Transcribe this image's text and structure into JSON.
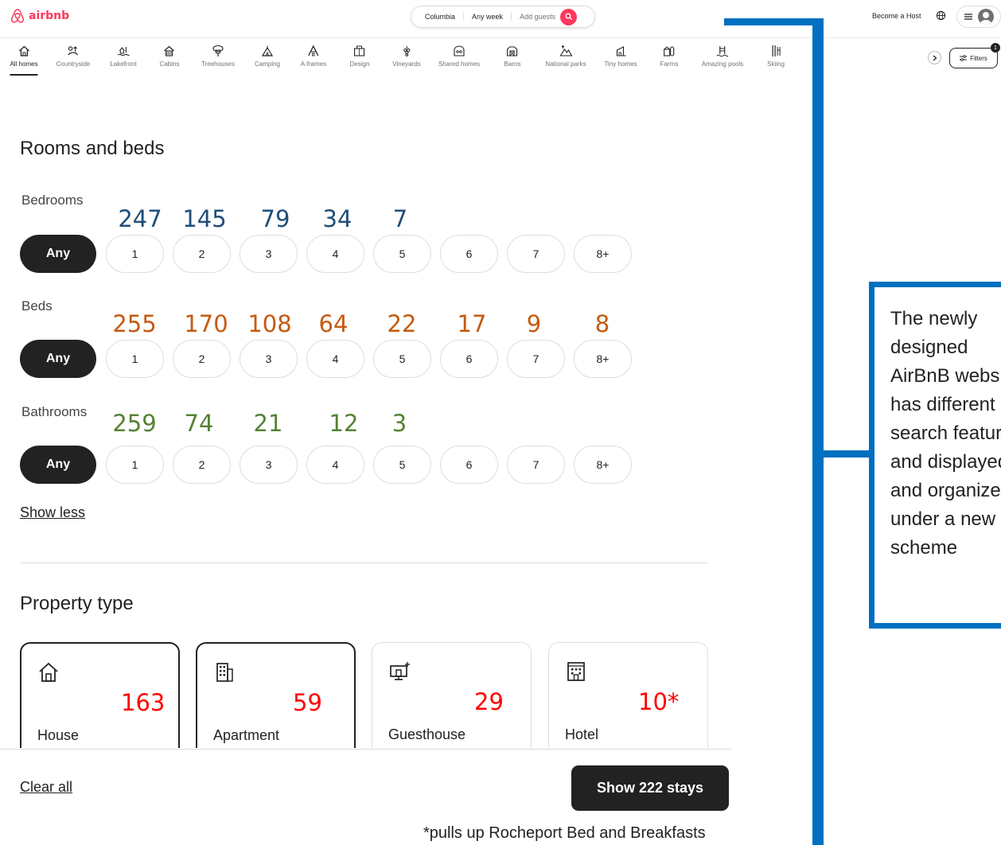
{
  "header": {
    "logo_text": "airbnb",
    "brand_color": "#FF385C",
    "search": {
      "location": "Columbia",
      "week": "Any week",
      "guests": "Add guests"
    },
    "become_host": "Become a Host",
    "icons": [
      "globe-icon",
      "hamburger-icon",
      "avatar"
    ]
  },
  "categories": [
    {
      "label": "All homes"
    },
    {
      "label": "Countryside"
    },
    {
      "label": "Lakefront"
    },
    {
      "label": "Cabins"
    },
    {
      "label": "Treehouses"
    },
    {
      "label": "Camping"
    },
    {
      "label": "A-frames"
    },
    {
      "label": "Design"
    },
    {
      "label": "Vineyards"
    },
    {
      "label": "Shared homes"
    },
    {
      "label": "Barns"
    },
    {
      "label": "National parks"
    },
    {
      "label": "Tiny homes"
    },
    {
      "label": "Farms"
    },
    {
      "label": "Amazing pools"
    },
    {
      "label": "Skiing"
    }
  ],
  "filters": {
    "label": "Filters",
    "badge": "1"
  },
  "rooms": {
    "title": "Rooms and beds",
    "any_label": "Any",
    "options": [
      "1",
      "2",
      "3",
      "4",
      "5",
      "6",
      "7",
      "8+"
    ],
    "bedrooms": {
      "label": "Bedrooms",
      "counts": [
        "247",
        "145",
        "79",
        "34",
        "7"
      ],
      "color": "#1f4e79"
    },
    "beds": {
      "label": "Beds",
      "counts": [
        "255",
        "170",
        "108",
        "64",
        "22",
        "17",
        "9",
        "8"
      ],
      "color": "#c55a11"
    },
    "bathrooms": {
      "label": "Bathrooms",
      "counts": [
        "259",
        "74",
        "21",
        "12",
        "3"
      ],
      "color": "#548235"
    },
    "show_less": "Show less"
  },
  "property": {
    "title": "Property type",
    "types": [
      {
        "name": "House",
        "count": "163",
        "icon": "house-icon"
      },
      {
        "name": "Apartment",
        "count": "59",
        "icon": "apartment-icon"
      },
      {
        "name": "Guesthouse",
        "count": "29",
        "icon": "guesthouse-icon"
      },
      {
        "name": "Hotel",
        "count": "10*",
        "icon": "hotel-icon"
      }
    ],
    "count_color": "#ff0000"
  },
  "footer": {
    "clear_all": "Clear all",
    "show_stays": "Show 222 stays",
    "footnote": "*pulls up Rocheport Bed and Breakfasts"
  },
  "annotation": {
    "text": "The newly designed AirBnB website has different search features and displayed and organized under a new scheme",
    "color": "#0070c0"
  }
}
